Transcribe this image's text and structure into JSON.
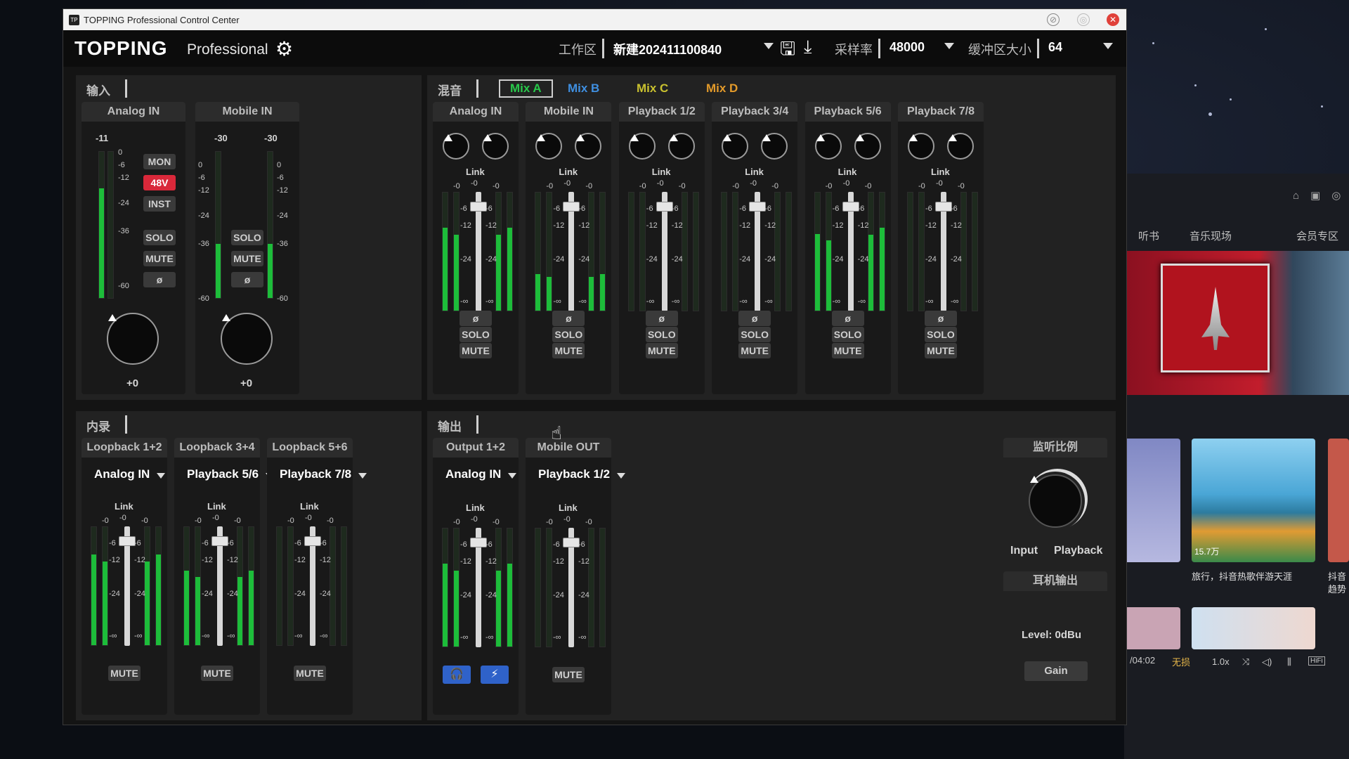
{
  "window": {
    "title": "TOPPING Professional Control Center",
    "brand": "TOPPING",
    "brand_sub": "Professional"
  },
  "header": {
    "workspace_label": "工作区",
    "workspace_value": "新建202411100840",
    "sample_rate_label": "采样率",
    "sample_rate_value": "48000",
    "buffer_label": "缓冲区大小",
    "buffer_value": "64"
  },
  "input_panel": {
    "title": "输入",
    "channels": [
      {
        "name": "Analog IN",
        "peak": "-11",
        "gain": "+0",
        "buttons": [
          "MON",
          "48V",
          "INST",
          "SOLO",
          "MUTE",
          "ø"
        ],
        "level": 0.75
      },
      {
        "name": "Mobile IN",
        "peak_l": "-30",
        "peak_r": "-30",
        "gain": "+0",
        "buttons": [
          "SOLO",
          "MUTE",
          "ø"
        ],
        "level_l": 0.37,
        "level_r": 0.37
      }
    ],
    "scale": [
      "0",
      "-6",
      "-12",
      "-24",
      "-36",
      "-60"
    ]
  },
  "mix_panel": {
    "title": "混音",
    "tabs": [
      {
        "label": "Mix A",
        "color": "#28c84a",
        "active": true
      },
      {
        "label": "Mix B",
        "color": "#3f8fe0",
        "active": false
      },
      {
        "label": "Mix C",
        "color": "#c9c12f",
        "active": false
      },
      {
        "label": "Mix D",
        "color": "#e39a2a",
        "active": false
      }
    ],
    "channels": [
      {
        "name": "Analog IN",
        "level_l": 0.7,
        "level_r": 0.7
      },
      {
        "name": "Mobile IN",
        "level_l": 0.31,
        "level_r": 0.31
      },
      {
        "name": "Playback 1/2",
        "level_l": 0,
        "level_r": 0
      },
      {
        "name": "Playback 3/4",
        "level_l": 0,
        "level_r": 0
      },
      {
        "name": "Playback 5/6",
        "level_l": 0.65,
        "level_r": 0.7
      },
      {
        "name": "Playback 7/8",
        "level_l": 0,
        "level_r": 0
      }
    ],
    "link_label": "Link",
    "fader_value": "-0",
    "side_value": "-0",
    "scale": [
      "-6",
      "-12",
      "-24",
      "-∞"
    ],
    "phase_label": "ø",
    "solo_label": "SOLO",
    "mute_label": "MUTE"
  },
  "loopback_panel": {
    "title": "内录",
    "channels": [
      {
        "name": "Loopback 1+2",
        "source": "Analog IN",
        "level_l": 0.77,
        "level_r": 0.77
      },
      {
        "name": "Loopback 3+4",
        "source": "Playback 5/6",
        "level_l": 0.63,
        "level_r": 0.63
      },
      {
        "name": "Loopback 5+6",
        "source": "Playback 7/8",
        "level_l": 0,
        "level_r": 0
      }
    ],
    "link_label": "Link",
    "mute_label": "MUTE"
  },
  "output_panel": {
    "title": "输出",
    "channels": [
      {
        "name": "Output 1+2",
        "source": "Analog IN",
        "level_l": 0.7,
        "level_r": 0.7,
        "icons": [
          "headphones-icon",
          "mic-link-icon"
        ]
      },
      {
        "name": "Mobile OUT",
        "source": "Playback 1/2",
        "level_l": 0,
        "level_r": 0,
        "button": "MUTE"
      }
    ],
    "link_label": "Link",
    "monitor_ratio_title": "监听比例",
    "monitor_left": "Input",
    "monitor_right": "Playback",
    "headphone_title": "耳机输出",
    "headphone_level": "Level:  0dBu",
    "gain_button": "Gain"
  },
  "background_app": {
    "tabs": [
      "听书",
      "音乐现场",
      "会员专区"
    ],
    "card_caption_1": "旅行，抖音热歌伴游天涯",
    "card_caption_2": "抖音",
    "card_caption_2b": "趋势",
    "plays": "15.7万",
    "time": "/04:02",
    "quality": "无损",
    "speed": "1.0x",
    "hifi": "HiFi"
  }
}
